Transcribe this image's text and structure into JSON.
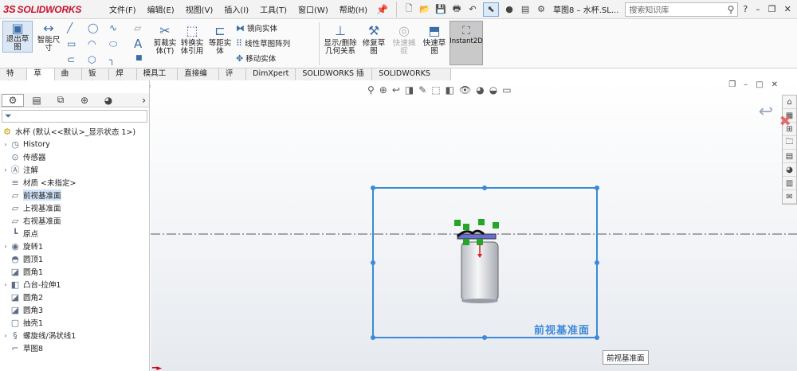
{
  "app": {
    "brand_prefix": "3S",
    "brand": "SOLIDWORKS"
  },
  "menu": [
    "文件(F)",
    "编辑(E)",
    "视图(V)",
    "插入(I)",
    "工具(T)",
    "窗口(W)",
    "帮助(H)"
  ],
  "document_title": "草图8 – 水杯.SL...",
  "search": {
    "placeholder": "搜索知识库"
  },
  "ribbon": {
    "exit_sketch": "退出草图",
    "smart_dimension": "智能尺寸",
    "trim_entities": "剪裁实体(T)",
    "convert_entities": "转换实体引用",
    "offset_entities": "等距实体",
    "mirror_entities": "镜向实体",
    "linear_pattern": "线性草图阵列",
    "move_entities": "移动实体",
    "display_delete_relations": "显示/删除几何关系",
    "repair_sketch": "修复草图",
    "quick_snaps": "快速捕捉",
    "rapid_sketch": "快速草图",
    "instant2d": "Instant2D"
  },
  "tabs": [
    "特征",
    "草图",
    "曲面",
    "钣金",
    "焊件",
    "模具工具",
    "直接编辑",
    "评估",
    "DimXpert",
    "SOLIDWORKS 插件",
    "SOLIDWORKS MBD"
  ],
  "active_tab": "草图",
  "tree": {
    "root": "水杯 (默认<<默认>_显示状态 1>)",
    "items": [
      {
        "label": "History",
        "icon": "history-icon",
        "expandable": true
      },
      {
        "label": "传感器",
        "icon": "sensor-icon",
        "expandable": false
      },
      {
        "label": "注解",
        "icon": "annotation-icon",
        "expandable": true
      },
      {
        "label": "材质 <未指定>",
        "icon": "material-icon",
        "expandable": false
      },
      {
        "label": "前视基准面",
        "icon": "plane-icon",
        "expandable": false,
        "selected": true
      },
      {
        "label": "上视基准面",
        "icon": "plane-icon",
        "expandable": false
      },
      {
        "label": "右视基准面",
        "icon": "plane-icon",
        "expandable": false
      },
      {
        "label": "原点",
        "icon": "origin-icon",
        "expandable": false
      },
      {
        "label": "旋转1",
        "icon": "revolve-icon",
        "expandable": true
      },
      {
        "label": "圆顶1",
        "icon": "dome-icon",
        "expandable": false
      },
      {
        "label": "圆角1",
        "icon": "fillet-icon",
        "expandable": false
      },
      {
        "label": "凸台-拉伸1",
        "icon": "extrude-icon",
        "expandable": true
      },
      {
        "label": "圆角2",
        "icon": "fillet-icon",
        "expandable": false
      },
      {
        "label": "圆角3",
        "icon": "fillet-icon",
        "expandable": false
      },
      {
        "label": "抽壳1",
        "icon": "shell-icon",
        "expandable": false
      },
      {
        "label": "螺旋线/涡状线1",
        "icon": "helix-icon",
        "expandable": true
      },
      {
        "label": "草图8",
        "icon": "sketch-icon",
        "expandable": false
      }
    ]
  },
  "viewport": {
    "plane_label": "前视基准面",
    "tooltip": "前视基准面"
  },
  "colors": {
    "brand": "#c8102e",
    "plane": "#3b8ad8",
    "accent": "#3b6da8"
  }
}
